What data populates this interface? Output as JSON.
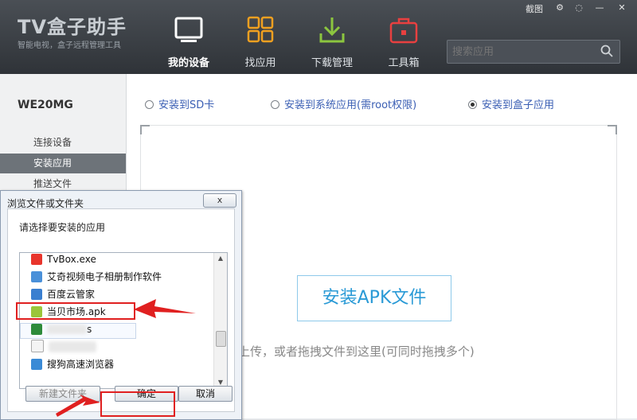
{
  "header": {
    "logo": "TV盒子助手",
    "slogan": "智能电视，盒子远程管理工具",
    "nav": [
      {
        "label": "我的设备",
        "icon": "monitor-icon",
        "active": true
      },
      {
        "label": "找应用",
        "icon": "grid-icon",
        "active": false
      },
      {
        "label": "下载管理",
        "icon": "download-icon",
        "active": false
      },
      {
        "label": "工具箱",
        "icon": "toolbox-icon",
        "active": false
      }
    ],
    "screenshot_label": "截图",
    "search_placeholder": "搜索应用"
  },
  "sidebar": {
    "device_name": "WE20MG",
    "items": [
      {
        "label": "连接设备",
        "active": false
      },
      {
        "label": "安装应用",
        "active": true
      },
      {
        "label": "推送文件",
        "active": false
      }
    ]
  },
  "main": {
    "options": [
      {
        "label": "安装到SD卡",
        "selected": false
      },
      {
        "label": "安装到系统应用(需root权限)",
        "selected": false
      },
      {
        "label": "安装到盒子应用",
        "selected": true
      }
    ],
    "install_button": "安装APK文件",
    "hint": "击上传，或者拖拽文件到这里(可同时拖拽多个)"
  },
  "dialog": {
    "title": "浏览文件或文件夹",
    "close": "x",
    "prompt": "请选择要安装的应用",
    "files": [
      {
        "name": "TvBox.exe",
        "icon": "red-app-icon"
      },
      {
        "name": "艾奇视频电子相册制作软件",
        "icon": "shortcut-icon"
      },
      {
        "name": "百度云管家",
        "icon": "shortcut-icon"
      },
      {
        "name": "当贝市场.apk",
        "icon": "android-apk-icon"
      },
      {
        "name": "s",
        "icon": "excel-icon"
      },
      {
        "name": "",
        "icon": "document-icon"
      },
      {
        "name": "搜狗高速浏览器",
        "icon": "shortcut-icon"
      }
    ],
    "new_folder": "新建文件夹",
    "ok": "确定",
    "cancel": "取消"
  },
  "colors": {
    "header_bg": "#3a3e43",
    "accent_blue": "#2a9ad6",
    "annotation_red": "#e02020"
  }
}
